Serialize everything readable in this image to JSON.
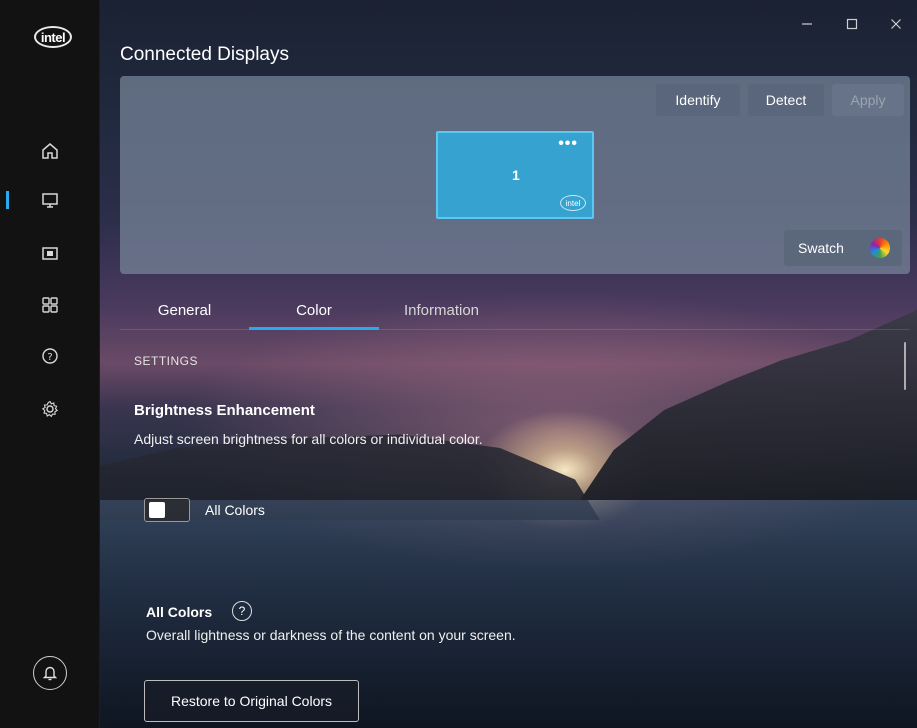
{
  "app": {
    "logo_text": "intel"
  },
  "window": {
    "minimize_icon": "minimize-icon",
    "maximize_icon": "maximize-icon",
    "close_icon": "close-icon"
  },
  "sidebar": {
    "items": [
      {
        "name": "home",
        "icon": "home-icon"
      },
      {
        "name": "display",
        "icon": "monitor-icon",
        "active": true
      },
      {
        "name": "video",
        "icon": "video-icon"
      },
      {
        "name": "apps",
        "icon": "grid-icon"
      },
      {
        "name": "help",
        "icon": "help-icon"
      },
      {
        "name": "settings",
        "icon": "gear-icon"
      }
    ],
    "notification_icon": "bell-icon"
  },
  "header": {
    "title": "Connected Displays"
  },
  "display_panel": {
    "identify_label": "Identify",
    "detect_label": "Detect",
    "apply_label": "Apply",
    "monitor": {
      "number": "1",
      "menu": "•••",
      "logo": "intel"
    },
    "swatch_label": "Swatch"
  },
  "tabs": [
    {
      "label": "General"
    },
    {
      "label": "Color",
      "active": true
    },
    {
      "label": "Information"
    }
  ],
  "content": {
    "section_label": "SETTINGS",
    "brightness": {
      "heading": "Brightness Enhancement",
      "description": "Adjust screen brightness for all colors or individual color.",
      "toggle_label": "All Colors",
      "toggle_on": false
    },
    "all_colors": {
      "heading": "All Colors",
      "help": "?",
      "description": "Overall lightness or darkness of the content on your screen.",
      "restore_label": "Restore to Original Colors"
    }
  },
  "colors": {
    "accent": "#2aa9ef",
    "monitor_tile": "#36a2cf",
    "rail": "#121212"
  }
}
